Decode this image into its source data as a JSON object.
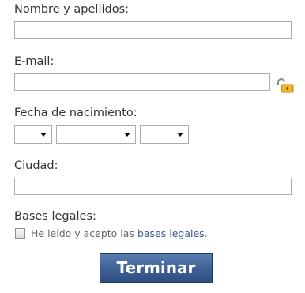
{
  "form": {
    "name": {
      "label": "Nombre y apellidos:",
      "value": ""
    },
    "email": {
      "label": "E-mail:",
      "value": "",
      "lock_icon": "unlocked-padlock-icon"
    },
    "birthdate": {
      "label": "Fecha de nacimiento:",
      "separator": "-",
      "day_value": "",
      "month_value": "",
      "year_value": ""
    },
    "city": {
      "label": "Ciudad:",
      "value": ""
    },
    "legal": {
      "label": "Bases legales:",
      "checkbox_checked": false,
      "text_before": "He leído y acepto las ",
      "link_text": "bases legales",
      "text_after": "."
    },
    "submit_label": "Terminar"
  },
  "colors": {
    "link": "#3b5998",
    "button": "#3d5f95",
    "lock": "#e8a317"
  }
}
